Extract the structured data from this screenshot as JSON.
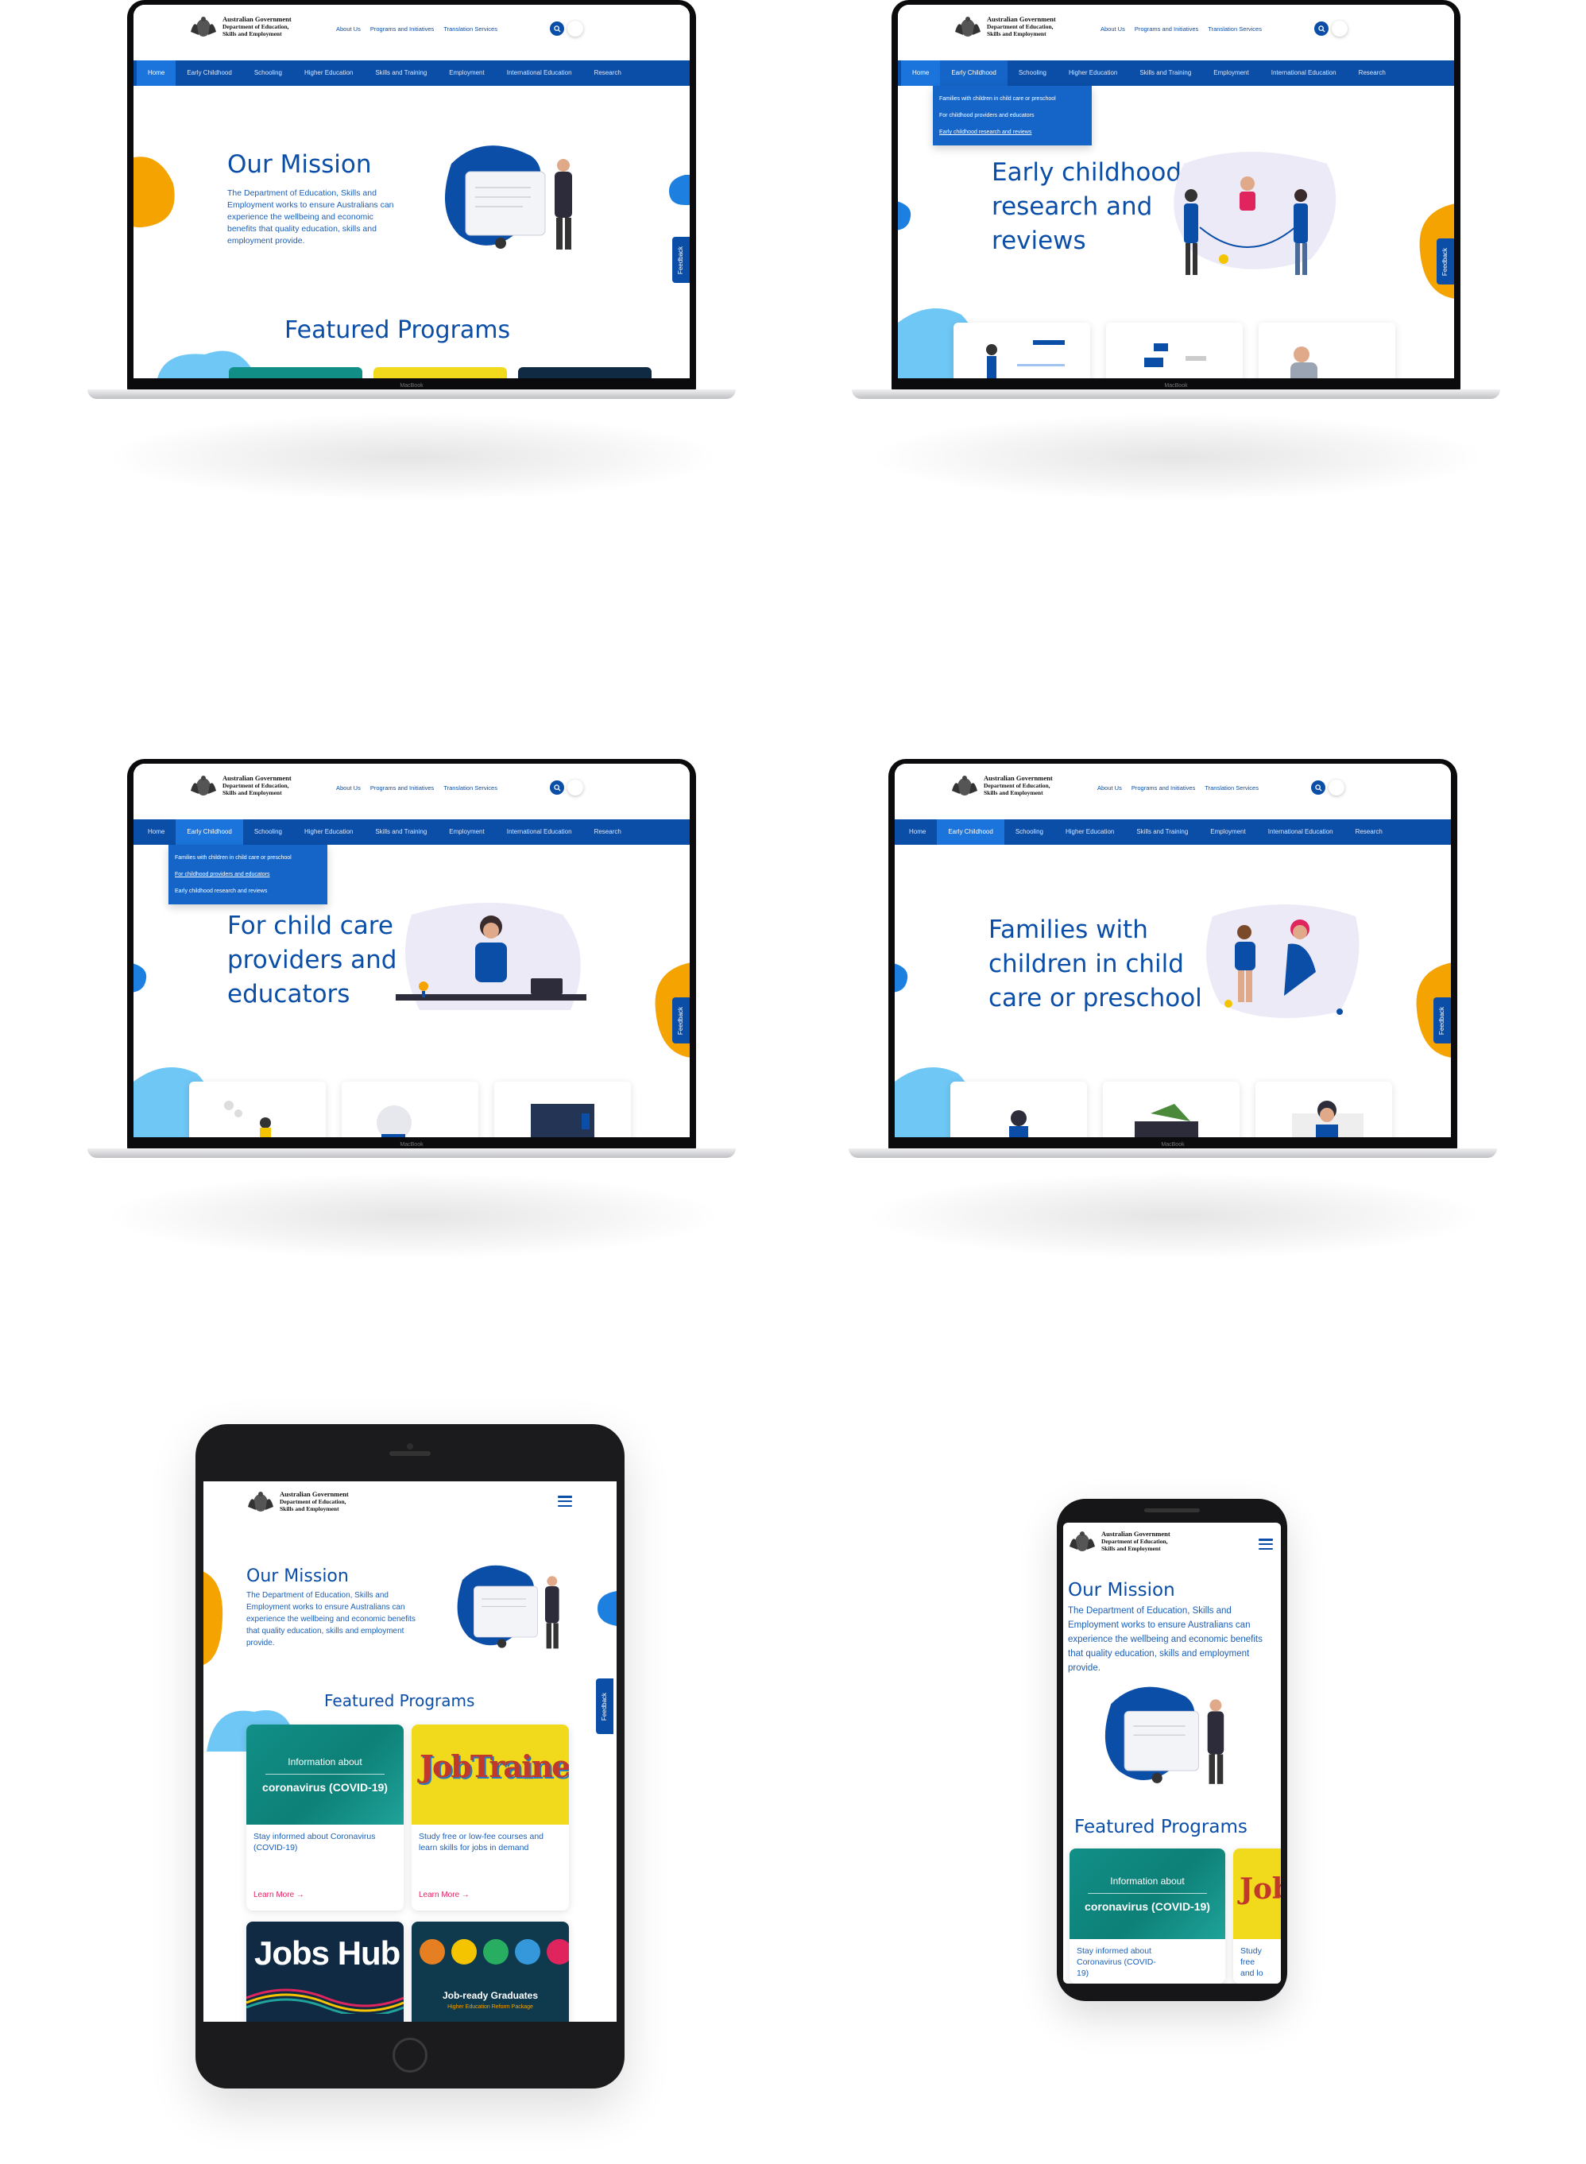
{
  "site": {
    "logo_line1": "Australian Government",
    "logo_line2": "Department of Education,",
    "logo_line3": "Skills and Employment",
    "top_nav": [
      "About Us",
      "Programs and Initiatives",
      "Translation Services"
    ],
    "main_nav": [
      "Home",
      "Early Childhood",
      "Schooling",
      "Higher Education",
      "Skills and Training",
      "Employment",
      "International Education",
      "Research"
    ],
    "dropdown_early_childhood": [
      "Families with children in child care or preschool",
      "For childhood providers and educators",
      "Early childhood research and reviews"
    ],
    "feedback_label": "Feedback",
    "device_label": "MacBook"
  },
  "screens": {
    "home": {
      "title": "Our Mission",
      "body": "The Department of Education, Skills and Employment works to ensure Australians can experience the wellbeing and economic benefits that quality education, skills and employment provide.",
      "featured": "Featured Programs"
    },
    "research": {
      "title_l1": "Early childhood",
      "title_l2": "research and",
      "title_l3": "reviews"
    },
    "providers": {
      "title_l1": "For child care",
      "title_l2": "providers and",
      "title_l3": "educators"
    },
    "families": {
      "title_l1": "Families with",
      "title_l2": "children in child",
      "title_l3": "care or preschool"
    }
  },
  "cards": [
    {
      "img_line1": "Information about",
      "img_line2": "coronavirus (COVID-19)",
      "text": "Stay informed about Coronavirus (COVID-19)",
      "link": "Learn More"
    },
    {
      "img_text": "JobTrainer",
      "text": "Study free or low-fee courses and learn skills for jobs in demand",
      "link": "Learn More"
    },
    {
      "img_text": "Jobs Hub"
    },
    {
      "img_text": "Job-ready Graduates",
      "img_sub": "Higher Education Reform Package"
    }
  ],
  "phone_card_partial": {
    "text_partial": "Study free",
    "text_partial2": "and lo"
  },
  "colors": {
    "brand_blue": "#0a4ea8",
    "nav_active": "#1a74db",
    "accent_orange": "#f5a300",
    "accent_lightblue": "#6fc7f5",
    "link_pink": "#e0245e",
    "teal": "#118f87",
    "yellow": "#f1da1b",
    "navy": "#102a43"
  },
  "icons": [
    "search-icon",
    "theme-toggle-icon",
    "hamburger-menu-icon",
    "arrow-right-icon",
    "australian-crest-icon"
  ]
}
